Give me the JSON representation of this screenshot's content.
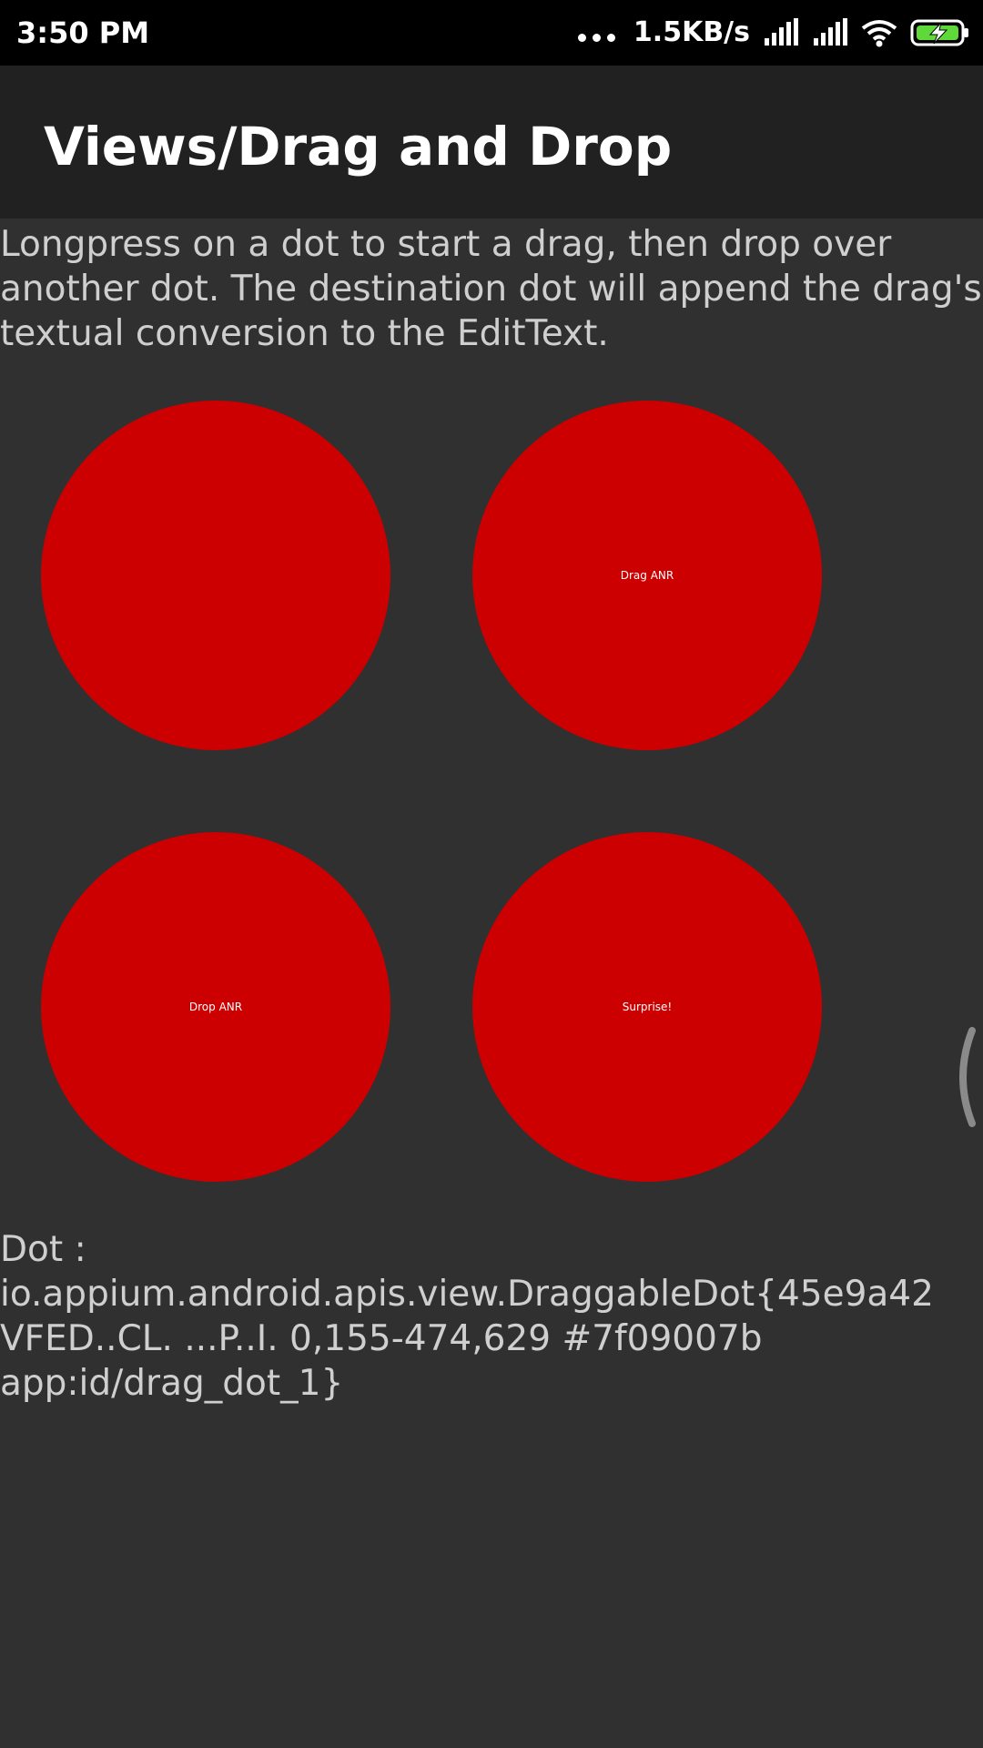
{
  "status_bar": {
    "time": "3:50 PM",
    "network_speed": "1.5KB/s",
    "icons": [
      "more-dots-icon",
      "signal-icon",
      "signal-icon",
      "wifi-icon",
      "battery-charging-icon"
    ],
    "battery_color": "#5fd93a"
  },
  "app_bar": {
    "title": "Views/Drag and Drop"
  },
  "instructions": "Longpress on a dot to start a drag, then drop over another dot. The destination dot will append the drag's textual conversion to the EditText.",
  "dots": {
    "color": "#cc0000",
    "dot1_label": "",
    "dot2_label": "Drag ANR",
    "dot3_label": "Drop ANR",
    "dot4_label": "Surprise!"
  },
  "result_text": "Dot : io.appium.android.apis.view.DraggableDot{45e9a42 VFED..CL. ...P..I. 0,155-474,629 #7f09007b app:id/drag_dot_1}"
}
